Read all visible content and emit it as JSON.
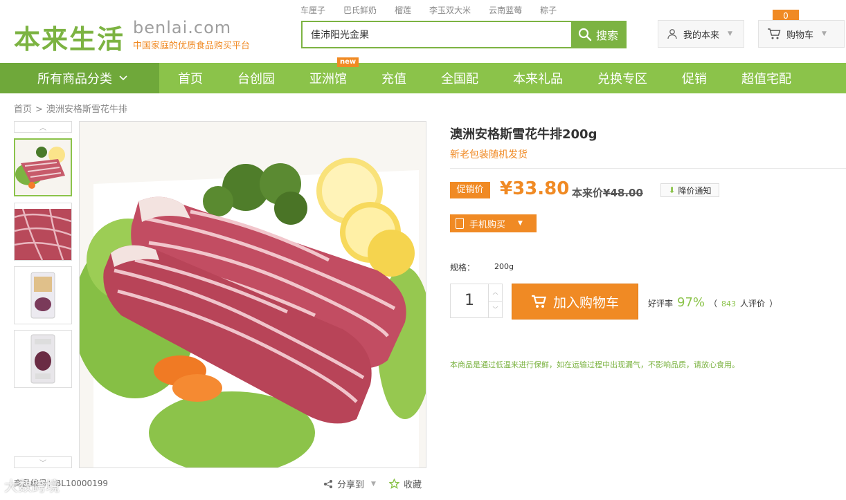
{
  "header": {
    "logo_cn": "本来生活",
    "logo_en": "benlai.com",
    "logo_slogan": "中国家庭的优质食品购买平台",
    "hot_words": [
      "车厘子",
      "巴氏鲜奶",
      "榴莲",
      "李玉双大米",
      "云南蓝莓",
      "粽子"
    ],
    "search_value": "佳沛阳光金果",
    "search_button": "搜索",
    "my_account": "我的本来",
    "cart_label": "购物车",
    "cart_count": "0"
  },
  "nav": {
    "all_categories": "所有商品分类",
    "items": [
      "首页",
      "台创园",
      "亚洲馆",
      "充值",
      "全国配",
      "本来礼品",
      "兑换专区",
      "促销",
      "超值宅配"
    ],
    "new_badge": "new"
  },
  "breadcrumb": {
    "home": "首页",
    "current": "澳洲安格斯雪花牛排"
  },
  "product": {
    "title": "澳洲安格斯雪花牛排200g",
    "subtitle": "新老包装随机发货",
    "promo_tag": "促销价",
    "price": "¥33.80",
    "orig_label": "本来价",
    "orig_price": "¥48.00",
    "notify": "降价通知",
    "mobile_buy": "手机购买",
    "spec_label": "规格：",
    "spec_value": "200g",
    "quantity": "1",
    "add_to_cart": "加入购物车",
    "rating_label": "好评率",
    "rating_pct": "97%",
    "review_count": "843",
    "review_label": "人评价",
    "notice": "本商品是通过低温来进行保鲜，如在运输过程中出现漏气，不影响品质，请放心食用。",
    "item_no_label": "商品编号：",
    "item_no": "BL10000199",
    "share": "分享到",
    "favorite": "收藏"
  },
  "watermark": "大数跨境",
  "colors": {
    "brand_green": "#8bc34a",
    "dark_green": "#6fa83a",
    "accent_orange": "#f08a24"
  }
}
